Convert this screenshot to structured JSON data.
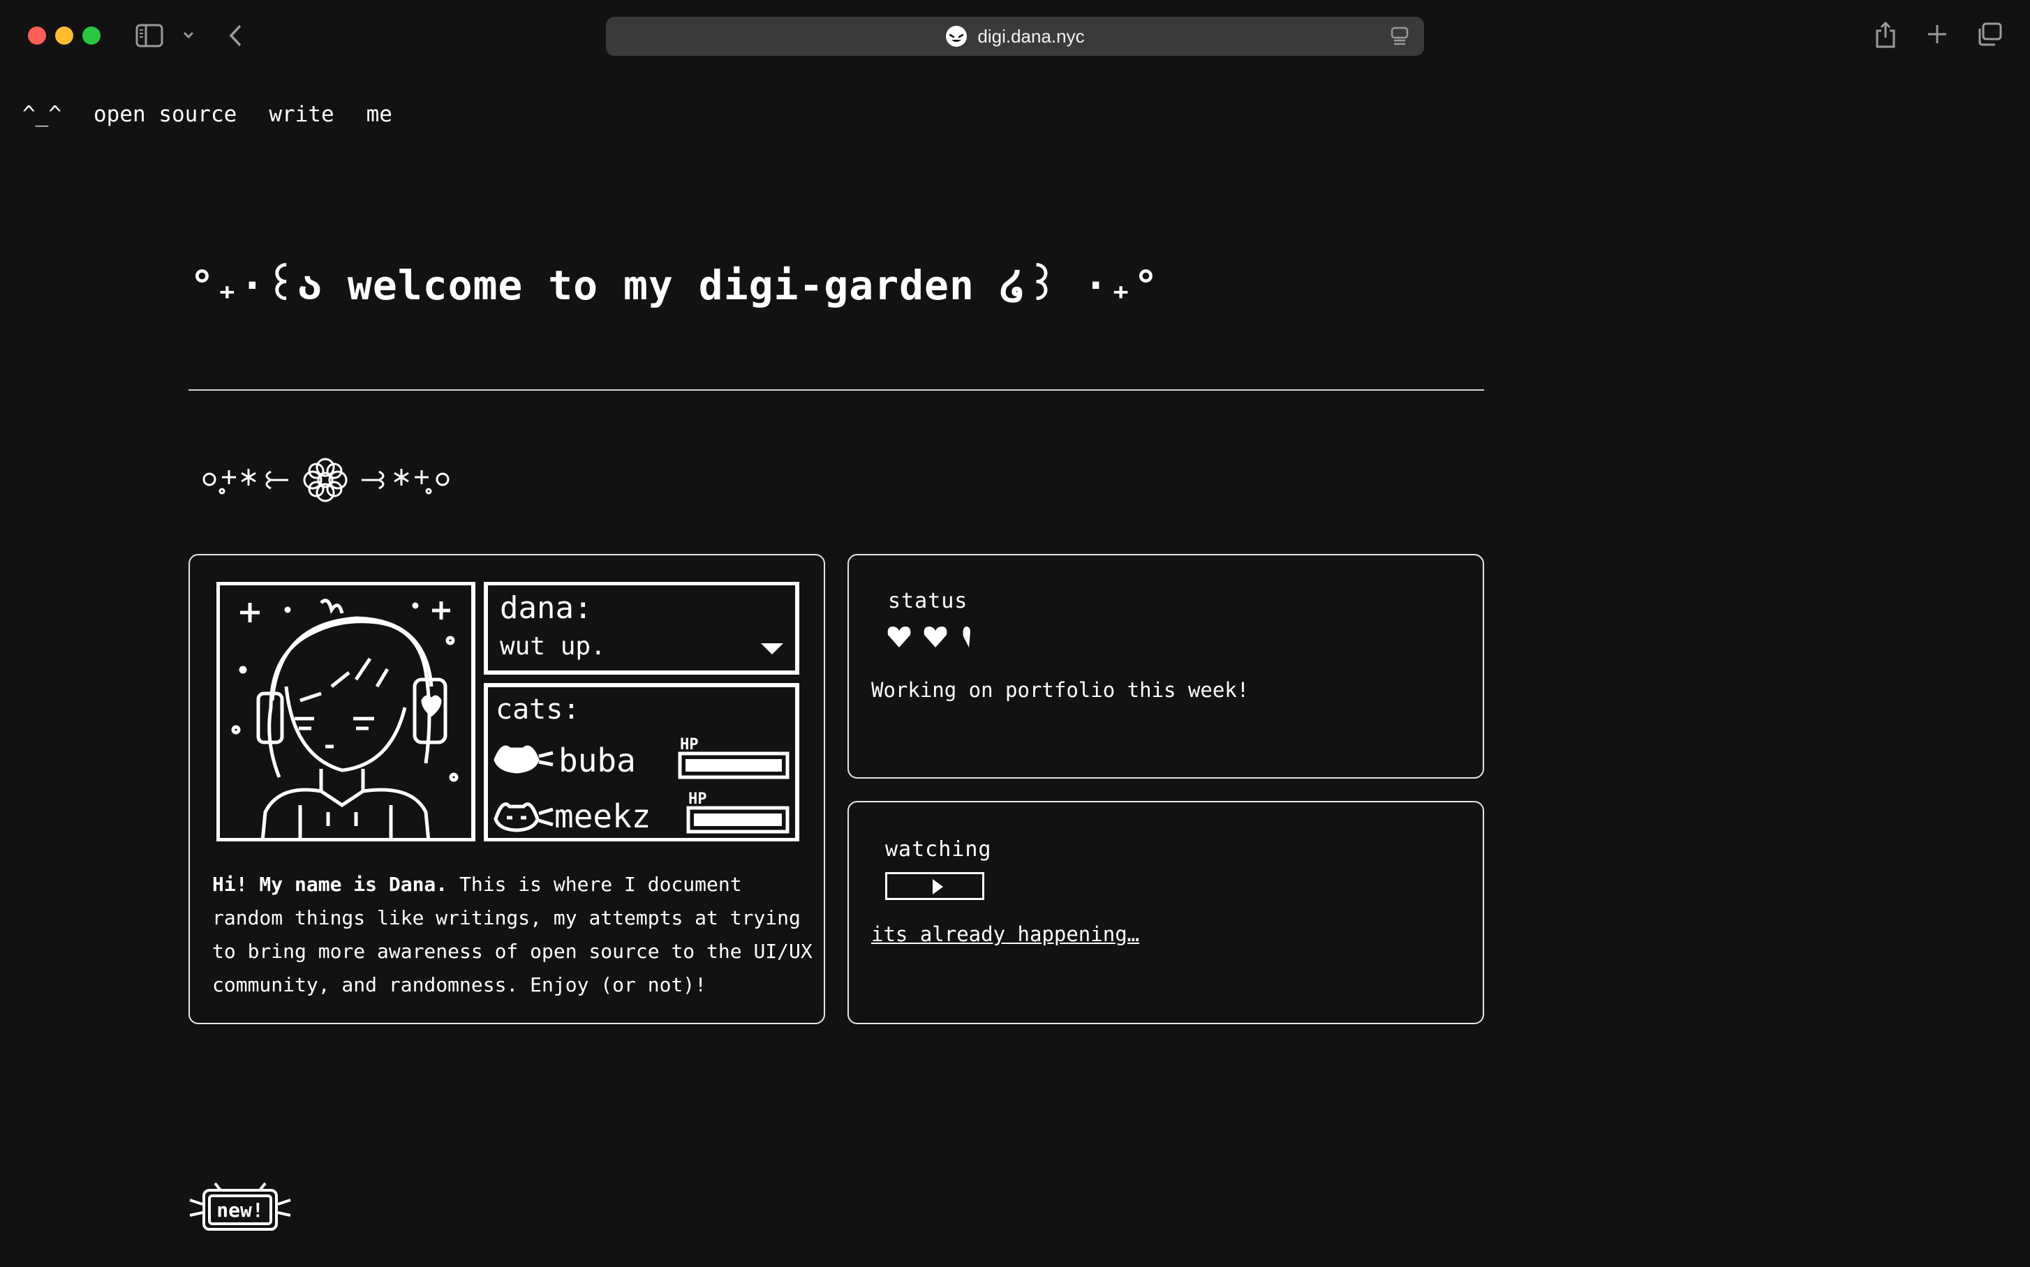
{
  "browser": {
    "url": "digi.dana.nyc",
    "icons": [
      "sidebar-icon",
      "chevron-down-icon",
      "back-icon",
      "reader-icon",
      "share-icon",
      "new-tab-icon",
      "tabs-overview-icon"
    ]
  },
  "nav": {
    "home": "^_^",
    "items": [
      "open source",
      "write",
      "me"
    ]
  },
  "title": "°₊·꒰ა welcome to my digi-garden ໒꒱ ·₊°",
  "decoration": "˚₊‧꒰ა ✿ ໒꒱‧₊˚",
  "profile": {
    "dialog_name": "dana:",
    "dialog_text": "wut up.",
    "cats_label": "cats:",
    "cats": [
      {
        "name": "buba",
        "hp_label": "HP",
        "hp": 1.0
      },
      {
        "name": "meekz",
        "hp_label": "HP",
        "hp": 1.0
      }
    ],
    "bio_bold": "Hi! My name is Dana.",
    "bio_rest": " This is where I document random things like writings, my attempts at trying to bring more awareness of open source to the UI/UX community, and randomness. Enjoy (or not)!"
  },
  "status": {
    "label": "status",
    "hearts": 2.5,
    "text": "Working on portfolio this week!"
  },
  "watching": {
    "label": "watching",
    "link": "its already happening…"
  },
  "badge": {
    "label": "new!"
  },
  "colors": {
    "background": "#121212",
    "foreground": "#ffffff",
    "border": "#e6e6e6",
    "urlbar": "#3a3a3c"
  }
}
